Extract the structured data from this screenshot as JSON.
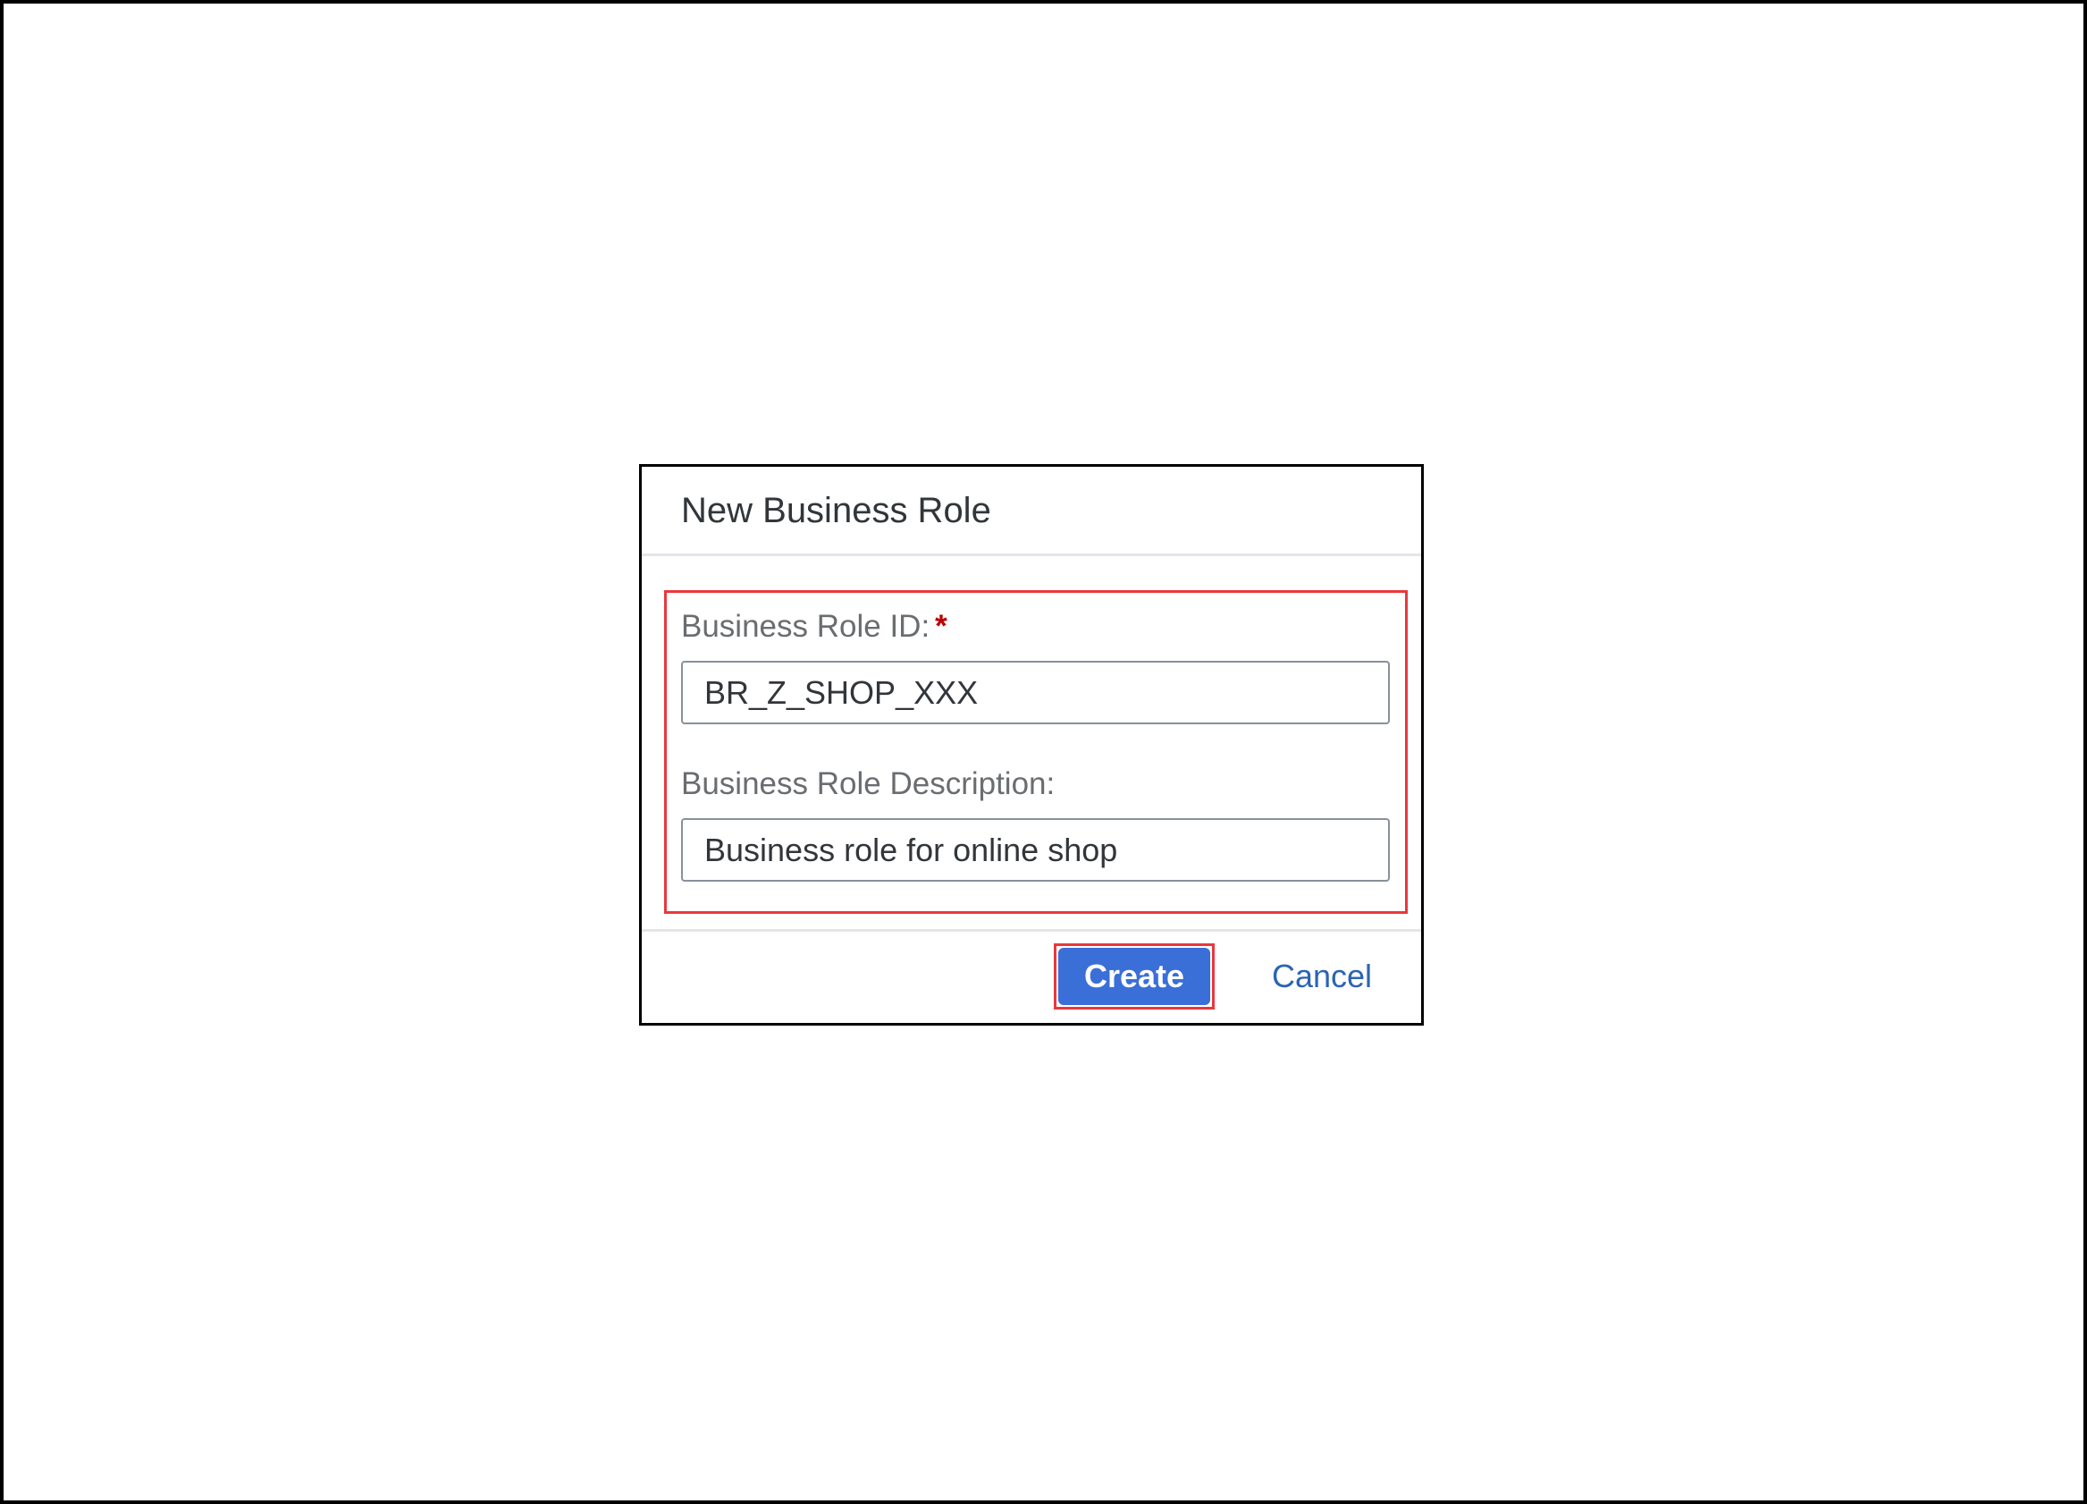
{
  "dialog": {
    "title": "New Business Role",
    "fields": [
      {
        "label": "Business Role ID:",
        "required": true,
        "required_marker": "*",
        "value": "BR_Z_SHOP_XXX"
      },
      {
        "label": "Business Role Description:",
        "required": false,
        "value": "Business role for online shop"
      }
    ],
    "buttons": {
      "create_label": "Create",
      "cancel_label": "Cancel"
    }
  },
  "colors": {
    "primary_button": "#3a6fd8",
    "link_text": "#2b64b3",
    "required_marker": "#bb0000",
    "highlight_annotation": "#e8383d"
  }
}
